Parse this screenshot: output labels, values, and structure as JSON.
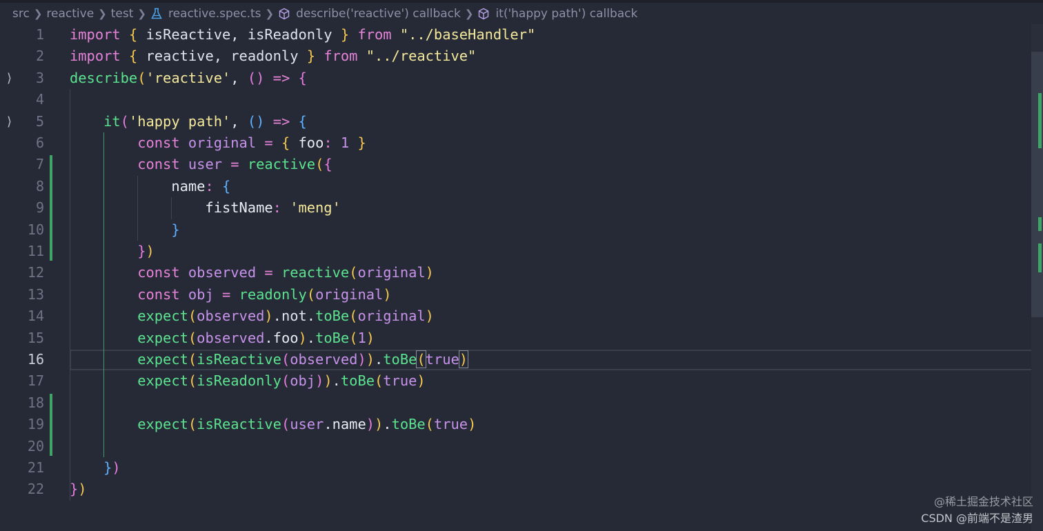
{
  "breadcrumb": {
    "items": [
      "src",
      "reactive",
      "test",
      "reactive.spec.ts",
      "describe('reactive') callback",
      "it('happy path') callback"
    ],
    "icons": [
      "",
      "",
      "",
      "test-flask-icon",
      "cube-symbol-icon",
      "cube-symbol-icon"
    ]
  },
  "editor": {
    "active_line": 16,
    "lines": [
      {
        "n": "1",
        "fold": "",
        "tokens": [
          [
            "kw",
            "import"
          ],
          [
            "pl",
            " "
          ],
          [
            "pn1",
            "{"
          ],
          [
            "pl",
            " isReactive, isReadonly "
          ],
          [
            "pn1",
            "}"
          ],
          [
            "pl",
            " "
          ],
          [
            "kw",
            "from"
          ],
          [
            "pl",
            " "
          ],
          [
            "str",
            "\"../baseHandler\""
          ]
        ]
      },
      {
        "n": "2",
        "fold": "",
        "tokens": [
          [
            "kw",
            "import"
          ],
          [
            "pl",
            " "
          ],
          [
            "pn1",
            "{"
          ],
          [
            "pl",
            " reactive, readonly "
          ],
          [
            "pn1",
            "}"
          ],
          [
            "pl",
            " "
          ],
          [
            "kw",
            "from"
          ],
          [
            "pl",
            " "
          ],
          [
            "str",
            "\"../reactive\""
          ]
        ]
      },
      {
        "n": "3",
        "fold": "⟩",
        "tokens": [
          [
            "fn",
            "describe"
          ],
          [
            "pn1",
            "("
          ],
          [
            "str",
            "'reactive'"
          ],
          [
            "pl",
            ", "
          ],
          [
            "pn2",
            "()"
          ],
          [
            "pl",
            " "
          ],
          [
            "op",
            "=>"
          ],
          [
            "pl",
            " "
          ],
          [
            "pn2",
            "{"
          ]
        ]
      },
      {
        "n": "4",
        "fold": "",
        "tokens": []
      },
      {
        "n": "5",
        "fold": "⟩",
        "tokens": [
          [
            "pl",
            "    "
          ],
          [
            "fn",
            "it"
          ],
          [
            "pn2",
            "("
          ],
          [
            "str",
            "'happy path'"
          ],
          [
            "pl",
            ", "
          ],
          [
            "pn3",
            "()"
          ],
          [
            "pl",
            " "
          ],
          [
            "op",
            "=>"
          ],
          [
            "pl",
            " "
          ],
          [
            "pn3",
            "{"
          ]
        ]
      },
      {
        "n": "6",
        "fold": "",
        "tokens": [
          [
            "pl",
            "        "
          ],
          [
            "kw",
            "const"
          ],
          [
            "pl",
            " "
          ],
          [
            "var",
            "original"
          ],
          [
            "pl",
            " "
          ],
          [
            "op",
            "="
          ],
          [
            "pl",
            " "
          ],
          [
            "pn1",
            "{"
          ],
          [
            "pl",
            " "
          ],
          [
            "prop",
            "foo"
          ],
          [
            "op",
            ":"
          ],
          [
            "pl",
            " "
          ],
          [
            "num",
            "1"
          ],
          [
            "pl",
            " "
          ],
          [
            "pn1",
            "}"
          ]
        ]
      },
      {
        "n": "7",
        "fold": "",
        "tokens": [
          [
            "pl",
            "        "
          ],
          [
            "kw",
            "const"
          ],
          [
            "pl",
            " "
          ],
          [
            "var",
            "user"
          ],
          [
            "pl",
            " "
          ],
          [
            "op",
            "="
          ],
          [
            "pl",
            " "
          ],
          [
            "fn",
            "reactive"
          ],
          [
            "pn1",
            "("
          ],
          [
            "pn2",
            "{"
          ]
        ]
      },
      {
        "n": "8",
        "fold": "",
        "tokens": [
          [
            "pl",
            "            "
          ],
          [
            "prop",
            "name"
          ],
          [
            "op",
            ":"
          ],
          [
            "pl",
            " "
          ],
          [
            "pn3",
            "{"
          ]
        ]
      },
      {
        "n": "9",
        "fold": "",
        "tokens": [
          [
            "pl",
            "                "
          ],
          [
            "prop",
            "fistName"
          ],
          [
            "op",
            ":"
          ],
          [
            "pl",
            " "
          ],
          [
            "str",
            "'meng'"
          ]
        ]
      },
      {
        "n": "10",
        "fold": "",
        "tokens": [
          [
            "pl",
            "            "
          ],
          [
            "pn3",
            "}"
          ]
        ]
      },
      {
        "n": "11",
        "fold": "",
        "tokens": [
          [
            "pl",
            "        "
          ],
          [
            "pn2",
            "}"
          ],
          [
            "pn1",
            ")"
          ]
        ]
      },
      {
        "n": "12",
        "fold": "",
        "tokens": [
          [
            "pl",
            "        "
          ],
          [
            "kw",
            "const"
          ],
          [
            "pl",
            " "
          ],
          [
            "var",
            "observed"
          ],
          [
            "pl",
            " "
          ],
          [
            "op",
            "="
          ],
          [
            "pl",
            " "
          ],
          [
            "fn",
            "reactive"
          ],
          [
            "pn1",
            "("
          ],
          [
            "var",
            "original"
          ],
          [
            "pn1",
            ")"
          ]
        ]
      },
      {
        "n": "13",
        "fold": "",
        "tokens": [
          [
            "pl",
            "        "
          ],
          [
            "kw",
            "const"
          ],
          [
            "pl",
            " "
          ],
          [
            "var",
            "obj"
          ],
          [
            "pl",
            " "
          ],
          [
            "op",
            "="
          ],
          [
            "pl",
            " "
          ],
          [
            "fn",
            "readonly"
          ],
          [
            "pn1",
            "("
          ],
          [
            "var",
            "original"
          ],
          [
            "pn1",
            ")"
          ]
        ]
      },
      {
        "n": "14",
        "fold": "",
        "tokens": [
          [
            "pl",
            "        "
          ],
          [
            "fn",
            "expect"
          ],
          [
            "pn1",
            "("
          ],
          [
            "var",
            "observed"
          ],
          [
            "pn1",
            ")"
          ],
          [
            "pl",
            ".not."
          ],
          [
            "fn",
            "toBe"
          ],
          [
            "pn1",
            "("
          ],
          [
            "var",
            "original"
          ],
          [
            "pn1",
            ")"
          ]
        ]
      },
      {
        "n": "15",
        "fold": "",
        "tokens": [
          [
            "pl",
            "        "
          ],
          [
            "fn",
            "expect"
          ],
          [
            "pn1",
            "("
          ],
          [
            "var",
            "observed"
          ],
          [
            "pl",
            "."
          ],
          [
            "prop",
            "foo"
          ],
          [
            "pn1",
            ")"
          ],
          [
            "pl",
            "."
          ],
          [
            "fn",
            "toBe"
          ],
          [
            "pn1",
            "("
          ],
          [
            "num",
            "1"
          ],
          [
            "pn1",
            ")"
          ]
        ]
      },
      {
        "n": "16",
        "fold": "",
        "tokens": [
          [
            "pl",
            "        "
          ],
          [
            "fn",
            "expect"
          ],
          [
            "pn1",
            "("
          ],
          [
            "fn",
            "isReactive"
          ],
          [
            "pn2",
            "("
          ],
          [
            "var",
            "observed"
          ],
          [
            "pn2",
            ")"
          ],
          [
            "pn1",
            ")"
          ],
          [
            "pl",
            "."
          ],
          [
            "fn",
            "toBe"
          ],
          [
            "pn1 brm",
            "("
          ],
          [
            "bool",
            "true"
          ],
          [
            "pn1 brm",
            ")"
          ]
        ]
      },
      {
        "n": "17",
        "fold": "",
        "tokens": [
          [
            "pl",
            "        "
          ],
          [
            "fn",
            "expect"
          ],
          [
            "pn1",
            "("
          ],
          [
            "fn",
            "isReadonly"
          ],
          [
            "pn2",
            "("
          ],
          [
            "var",
            "obj"
          ],
          [
            "pn2",
            ")"
          ],
          [
            "pn1",
            ")"
          ],
          [
            "pl",
            "."
          ],
          [
            "fn",
            "toBe"
          ],
          [
            "pn1",
            "("
          ],
          [
            "bool",
            "true"
          ],
          [
            "pn1",
            ")"
          ]
        ]
      },
      {
        "n": "18",
        "fold": "",
        "tokens": []
      },
      {
        "n": "19",
        "fold": "",
        "tokens": [
          [
            "pl",
            "        "
          ],
          [
            "fn",
            "expect"
          ],
          [
            "pn1",
            "("
          ],
          [
            "fn",
            "isReactive"
          ],
          [
            "pn2",
            "("
          ],
          [
            "var",
            "user"
          ],
          [
            "pl",
            "."
          ],
          [
            "prop",
            "name"
          ],
          [
            "pn2",
            ")"
          ],
          [
            "pn1",
            ")"
          ],
          [
            "pl",
            "."
          ],
          [
            "fn",
            "toBe"
          ],
          [
            "pn1",
            "("
          ],
          [
            "bool",
            "true"
          ],
          [
            "pn1",
            ")"
          ]
        ]
      },
      {
        "n": "20",
        "fold": "",
        "tokens": []
      },
      {
        "n": "21",
        "fold": "",
        "tokens": [
          [
            "pl",
            "    "
          ],
          [
            "pn3",
            "}"
          ],
          [
            "pn2",
            ")"
          ]
        ]
      },
      {
        "n": "22",
        "fold": "",
        "tokens": [
          [
            "pn2",
            "}"
          ],
          [
            "pn1",
            ")"
          ]
        ]
      }
    ]
  },
  "watermark": {
    "line1": "@稀土掘金技术社区",
    "line2": "CSDN @前端不是渣男"
  }
}
